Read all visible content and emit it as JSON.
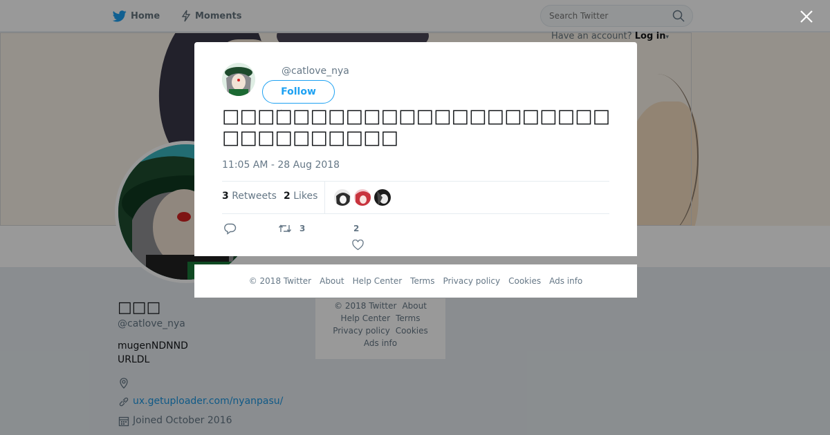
{
  "nav": {
    "home_label": "Home",
    "moments_label": "Moments",
    "search_placeholder": "Search Twitter",
    "have_account": "Have an account?",
    "login_label": "Log in"
  },
  "profile": {
    "name": "□□□",
    "handle": "@catlove_nya",
    "bio_line1": "mugenNDNND",
    "bio_line2": "URLDL",
    "url": "ux.getuploader.com/nyanpasu/",
    "joined": "Joined October 2016"
  },
  "side_footer": {
    "copyright": "© 2018 Twitter",
    "about": "About",
    "help": "Help Center",
    "terms": "Terms",
    "privacy": "Privacy policy",
    "cookies": "Cookies",
    "ads": "Ads info"
  },
  "tweet": {
    "handle": "@catlove_nya",
    "follow_label": "Follow",
    "text_line1": "□□□□□□□□□□□□□□□□□□□□□□",
    "text_line2": "□□□□□□□□□□",
    "timestamp": "11:05 AM - 28 Aug 2018",
    "retweets_count": "3",
    "retweets_label": "Retweets",
    "likes_count": "2",
    "likes_label": "Likes",
    "action_retweet_count": "3",
    "action_like_count": "2"
  },
  "modal_footer": {
    "copyright": "© 2018 Twitter",
    "about": "About",
    "help": "Help Center",
    "terms": "Terms",
    "privacy": "Privacy policy",
    "cookies": "Cookies",
    "ads": "Ads info"
  },
  "colors": {
    "brand": "#1da1f2",
    "link": "#1b95e0",
    "muted": "#657786"
  },
  "icons": [
    "twitter-bird-icon",
    "lightning-icon",
    "search-icon",
    "close-icon",
    "location-icon",
    "link-icon",
    "calendar-icon",
    "reply-icon",
    "retweet-icon",
    "heart-icon"
  ]
}
